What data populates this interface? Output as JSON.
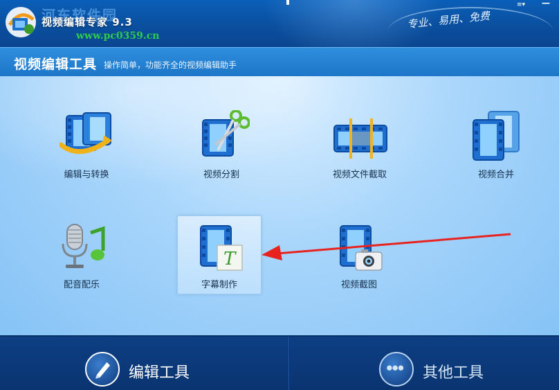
{
  "window": {
    "title": "视频编辑专家 9.3",
    "watermark_text": "河东软件园",
    "watermark_url": "www.pc0359.cn",
    "slogan": "专业、易用、免费",
    "menu_glyph": "≡▾",
    "minimize_glyph": "—"
  },
  "header": {
    "title": "视频编辑工具",
    "subtitle": "操作简单，功能齐全的视频编辑助手"
  },
  "tools": [
    {
      "label": "编辑与转换",
      "icon": "film-convert-icon"
    },
    {
      "label": "视频分割",
      "icon": "film-scissors-icon"
    },
    {
      "label": "视频文件截取",
      "icon": "film-trim-icon"
    },
    {
      "label": "视频合并",
      "icon": "film-merge-icon"
    },
    {
      "label": "配音配乐",
      "icon": "microphone-music-icon"
    },
    {
      "label": "字幕制作",
      "icon": "film-subtitle-icon",
      "selected": true
    },
    {
      "label": "视频截图",
      "icon": "film-camera-icon"
    }
  ],
  "bottom_nav": {
    "edit_tools": "编辑工具",
    "other_tools": "其他工具"
  },
  "annotation": {
    "color": "#e8231f"
  }
}
